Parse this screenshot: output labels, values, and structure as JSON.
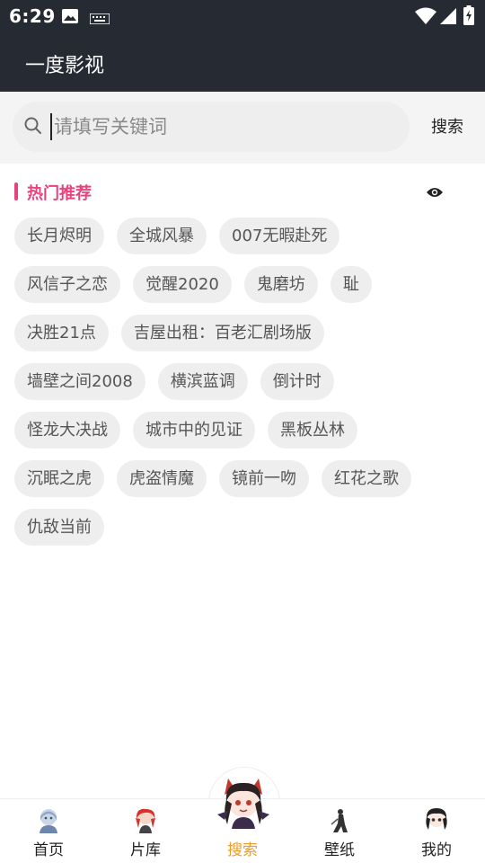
{
  "status_bar": {
    "time": "6:29"
  },
  "app_bar": {
    "title": "一度影视"
  },
  "search": {
    "placeholder": "请填写关键词",
    "value": "",
    "button_label": "搜索"
  },
  "hot": {
    "title": "热门推荐",
    "rows": [
      [
        "长月烬明",
        "全城风暴",
        "007无暇赴死"
      ],
      [
        "风信子之恋",
        "觉醒2020",
        "鬼磨坊",
        "耻"
      ],
      [
        "决胜21点",
        "吉屋出租：百老汇剧场版"
      ],
      [
        "墙壁之间2008",
        "横滨蓝调",
        "倒计时"
      ],
      [
        "怪龙大决战",
        "城市中的见证",
        "黑板丛林"
      ],
      [
        "沉眠之虎",
        "虎盗情魔",
        "镜前一吻",
        "红花之歌"
      ],
      [
        "仇敌当前"
      ]
    ]
  },
  "nav": {
    "items": [
      {
        "label": "首页",
        "icon": "home-avatar-icon"
      },
      {
        "label": "片库",
        "icon": "library-avatar-icon"
      },
      {
        "label": "搜索",
        "icon": "search-avatar-icon",
        "active": true
      },
      {
        "label": "壁纸",
        "icon": "wallpaper-avatar-icon"
      },
      {
        "label": "我的",
        "icon": "profile-avatar-icon"
      }
    ]
  },
  "colors": {
    "header_bg": "#252a33",
    "accent_pink": "#e8437e",
    "nav_active": "#ef9d2a",
    "tag_bg": "#eeeeee"
  }
}
